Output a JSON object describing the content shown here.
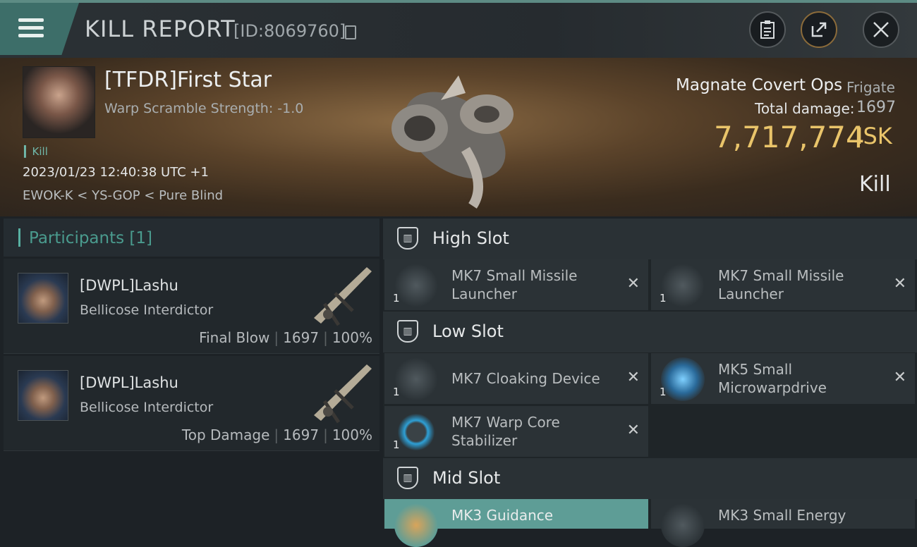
{
  "header": {
    "title": "KILL REPORT",
    "report_id": "[ID:8069760]"
  },
  "victim": {
    "name": "[TFDR]First Star",
    "warp_scramble": "Warp Scramble Strength: -1.0",
    "tag": "Kill",
    "time": "2023/01/23 12:40:38 UTC +1",
    "location": "EWOK-K < YS-GOP < Pure Blind",
    "ship_name": "Magnate Covert Ops",
    "ship_class": "Frigate",
    "total_damage_label": "Total damage:",
    "total_damage": "1697",
    "isk_value": "7,717,774",
    "isk_unit": "ISK",
    "result": "Kill"
  },
  "participants": {
    "title": "Participants",
    "count": "[1]",
    "list": [
      {
        "name": "[DWPL]Lashu",
        "ship": "Bellicose Interdictor",
        "role": "Final Blow",
        "damage": "1697",
        "percent": "100%"
      },
      {
        "name": "[DWPL]Lashu",
        "ship": "Bellicose Interdictor",
        "role": "Top Damage",
        "damage": "1697",
        "percent": "100%"
      }
    ]
  },
  "slots": {
    "high": {
      "title": "High Slot",
      "items": [
        {
          "name": "MK7 Small Missile Launcher",
          "qty": "1"
        },
        {
          "name": "MK7 Small Missile Launcher",
          "qty": "1"
        }
      ]
    },
    "low": {
      "title": "Low Slot",
      "items": [
        {
          "name": "MK7 Cloaking Device",
          "qty": "1"
        },
        {
          "name": "MK5 Small Microwarpdrive",
          "qty": "1"
        },
        {
          "name": "MK7 Warp Core Stabilizer",
          "qty": "1"
        }
      ]
    },
    "mid": {
      "title": "Mid Slot",
      "items": [
        {
          "name": "MK3 Guidance"
        },
        {
          "name": "MK3 Small Energy"
        }
      ]
    }
  },
  "icons": {
    "menu": "hamburger-icon",
    "clipboard": "clipboard-icon",
    "share": "share-icon",
    "close": "close-icon",
    "remove": "x-icon"
  },
  "colors": {
    "accent": "#5e9d96",
    "isk": "#e9c46a",
    "participants_title": "#4a9b8e"
  }
}
